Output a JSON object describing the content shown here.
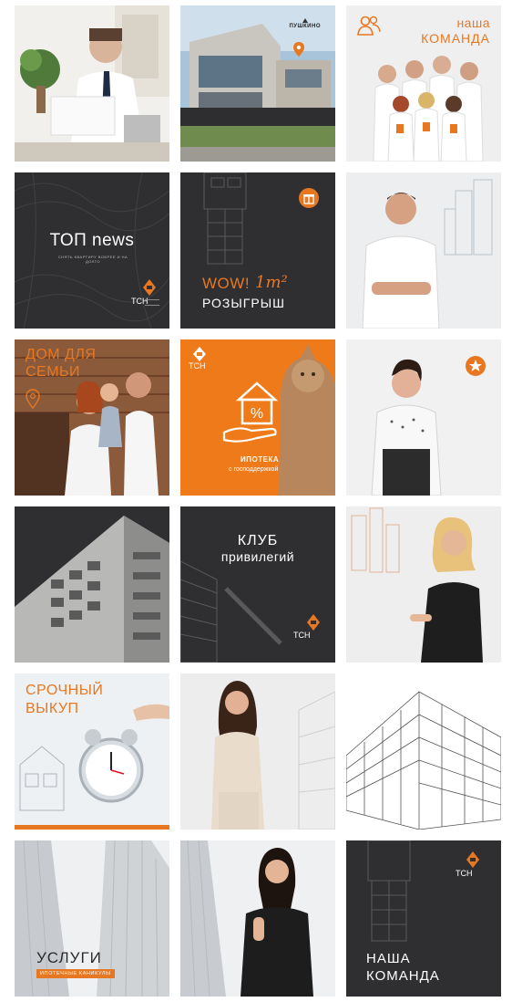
{
  "colors": {
    "accent": "#e87722",
    "dark": "#2f2f31",
    "light": "#eeeeee"
  },
  "tiles": {
    "t2": {
      "brand_line": "ПУШКИНО"
    },
    "t3": {
      "line1": "наша",
      "line2": "КОМАНДА",
      "icon": "team-icon"
    },
    "t4": {
      "title": "ТОП news",
      "subtitle": "СНЯТЬ КВАРТИРУ ВОБРЕЕ И НА ДОЛГО",
      "logo": "ТСН"
    },
    "t5": {
      "wow": "WOW!",
      "script": "1m²",
      "title": "РОЗЫГРЫШ",
      "icon": "gift-icon"
    },
    "t7": {
      "line1": "ДОМ ДЛЯ",
      "line2": "СЕМЬИ",
      "icon": "location-pin-icon"
    },
    "t8": {
      "logo": "ТСН",
      "line1": "ИПОТЕКА",
      "line2": "с господдержкой",
      "icon": "house-percent-hand-icon"
    },
    "t9": {
      "icon": "star-icon"
    },
    "t11": {
      "line1": "КЛУБ",
      "line2": "привилегий",
      "logo": "ТСН"
    },
    "t13": {
      "line1": "СРОЧНЫЙ",
      "line2": "ВЫКУП",
      "icon": "alarm-clock-icon"
    },
    "t16": {
      "title": "УСЛУГИ",
      "tag": "ИПОТЕЧНЫЕ КАНИКУЛЫ"
    },
    "t18": {
      "logo": "ТСН",
      "line1": "НАША",
      "line2": "КОМАНДА"
    }
  }
}
